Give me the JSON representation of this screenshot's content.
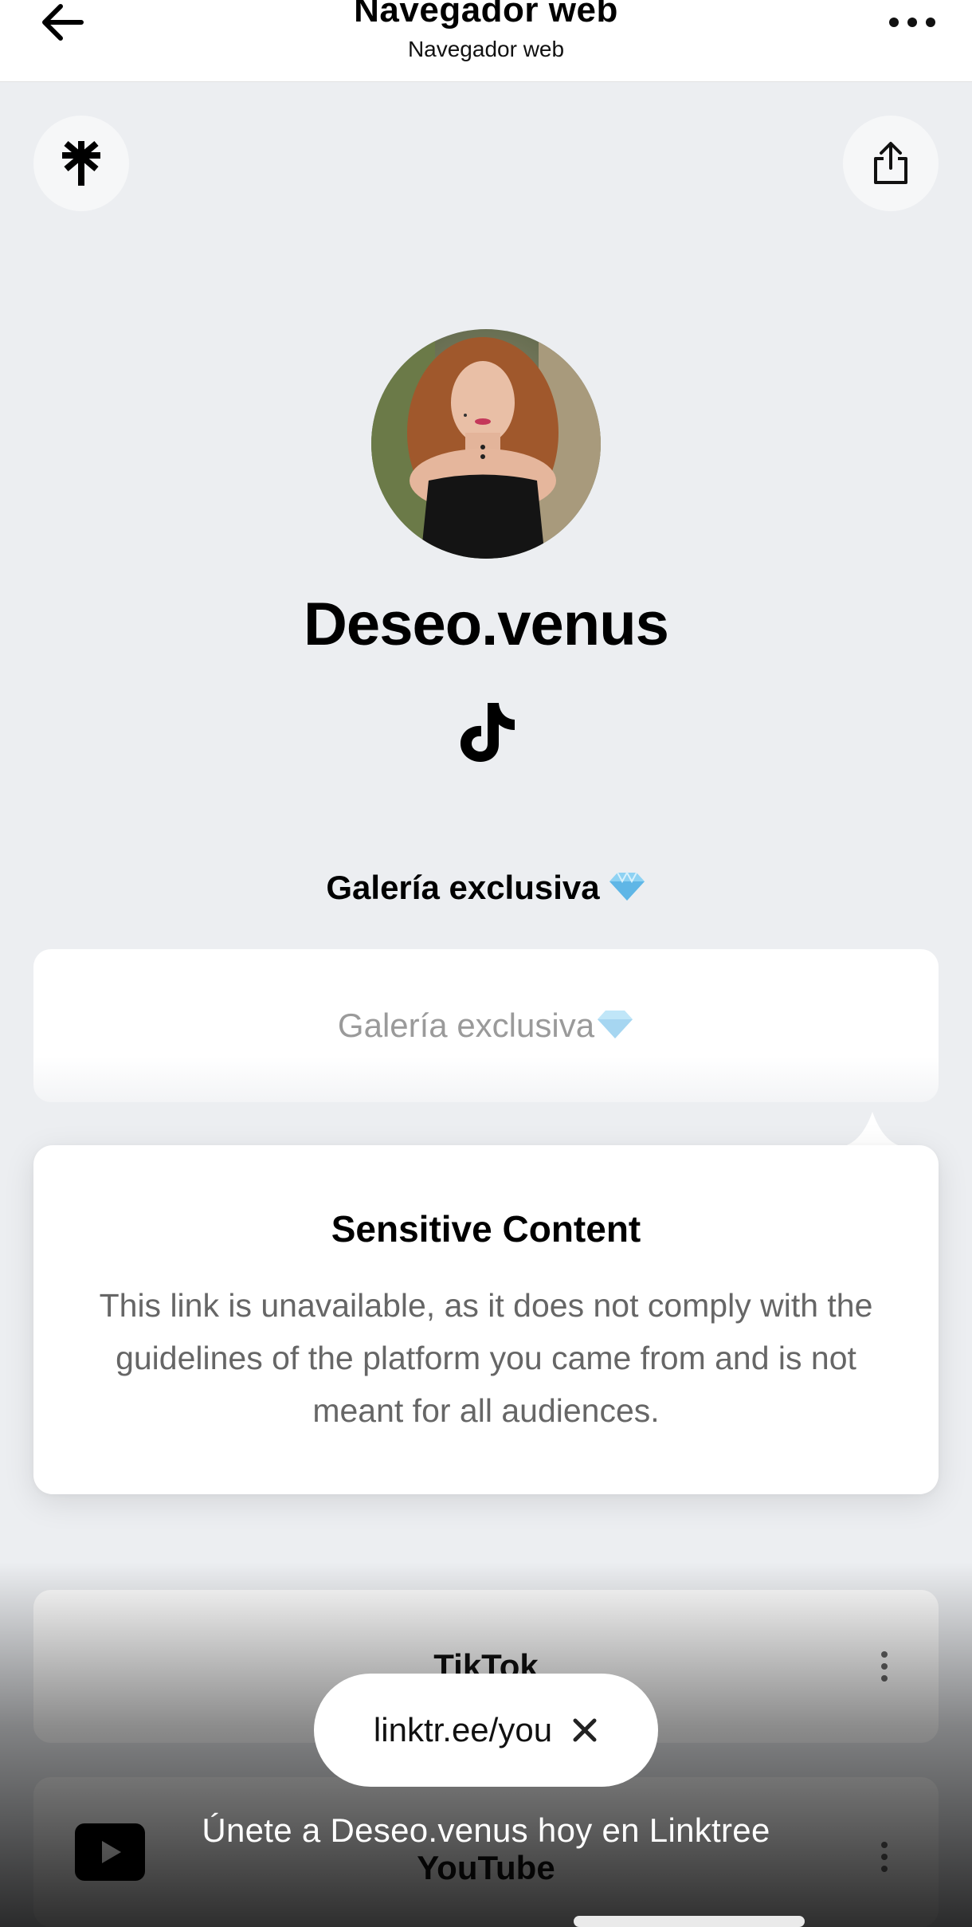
{
  "browser": {
    "title": "Navegador web",
    "subtitle": "Navegador web"
  },
  "profile": {
    "name": "Deseo.venus"
  },
  "section": {
    "title": "Galería exclusiva"
  },
  "links": {
    "gallery_label": "Galería exclusiva",
    "tiktok_label": "TikTok",
    "youtube_label": "YouTube"
  },
  "sensitive": {
    "title": "Sensitive Content",
    "body": "This link is unavailable, as it does not comply with the guidelines of the platform you came from and is not meant for all audiences."
  },
  "promo": {
    "url": "linktr.ee/you",
    "join_text": "Únete a Deseo.venus hoy en Linktree"
  },
  "colors": {
    "page_bg": "#eceef1",
    "card_bg": "#ffffff",
    "gem": "#7ec8f0"
  }
}
